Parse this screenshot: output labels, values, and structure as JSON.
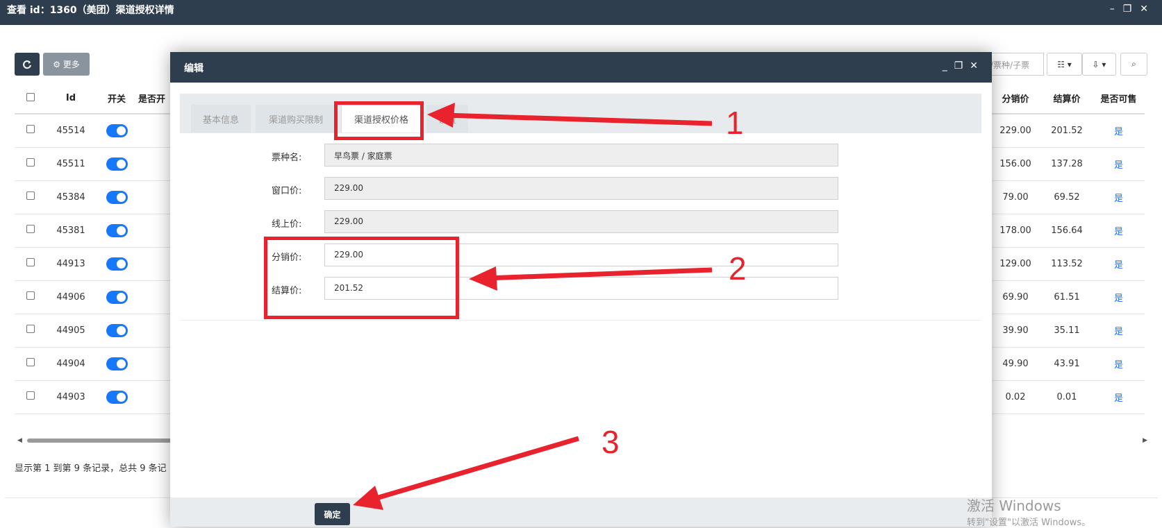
{
  "window": {
    "title": "查看 id：1360（美团）渠道授权详情",
    "controls": [
      "–",
      "❐",
      "✕"
    ]
  },
  "toolbar": {
    "refresh_icon": "refresh-icon",
    "more_label": "⚙ 更多",
    "search_placeholder": "/票种/子票",
    "cols_label": "☷ ▾",
    "export_label": "⇩ ▾",
    "search_btn": "⌕"
  },
  "table_left": {
    "headers": [
      "",
      "Id",
      "开关",
      "是否开"
    ],
    "rows": [
      {
        "id": "45514"
      },
      {
        "id": "45511"
      },
      {
        "id": "45384"
      },
      {
        "id": "45381"
      },
      {
        "id": "44913"
      },
      {
        "id": "44906"
      },
      {
        "id": "44905"
      },
      {
        "id": "44904"
      },
      {
        "id": "44903"
      }
    ]
  },
  "table_right": {
    "headers": [
      "分销价",
      "结算价",
      "是否可售"
    ],
    "rows": [
      [
        "229.00",
        "201.52",
        "是"
      ],
      [
        "156.00",
        "137.28",
        "是"
      ],
      [
        "79.00",
        "69.52",
        "是"
      ],
      [
        "178.00",
        "156.64",
        "是"
      ],
      [
        "129.00",
        "113.52",
        "是"
      ],
      [
        "69.90",
        "61.51",
        "是"
      ],
      [
        "39.90",
        "35.11",
        "是"
      ],
      [
        "49.90",
        "43.91",
        "是"
      ],
      [
        "0.02",
        "0.01",
        "是"
      ]
    ]
  },
  "pager_text": "显示第 1 到第 9 条记录，总共 9 条记",
  "modal": {
    "title": "编辑",
    "controls": [
      "_",
      "❐",
      "✕"
    ],
    "tabs": [
      "基本信息",
      "渠道购买限制",
      "渠道授权价格",
      "设置"
    ],
    "fields": [
      {
        "label": "票种名:",
        "value": "早鸟票 / 家庭票",
        "readonly": true
      },
      {
        "label": "窗口价:",
        "value": "229.00",
        "readonly": true
      },
      {
        "label": "线上价:",
        "value": "229.00",
        "readonly": true
      },
      {
        "label": "分销价:",
        "value": "229.00",
        "readonly": false
      },
      {
        "label": "结算价:",
        "value": "201.52",
        "readonly": false
      }
    ],
    "ok_label": "确定"
  },
  "annotations": {
    "n1": "1",
    "n2": "2",
    "n3": "3",
    "color": "#e8232e"
  },
  "watermark": {
    "line1": "激活 Windows",
    "line2": "转到\"设置\"以激活 Windows。"
  }
}
